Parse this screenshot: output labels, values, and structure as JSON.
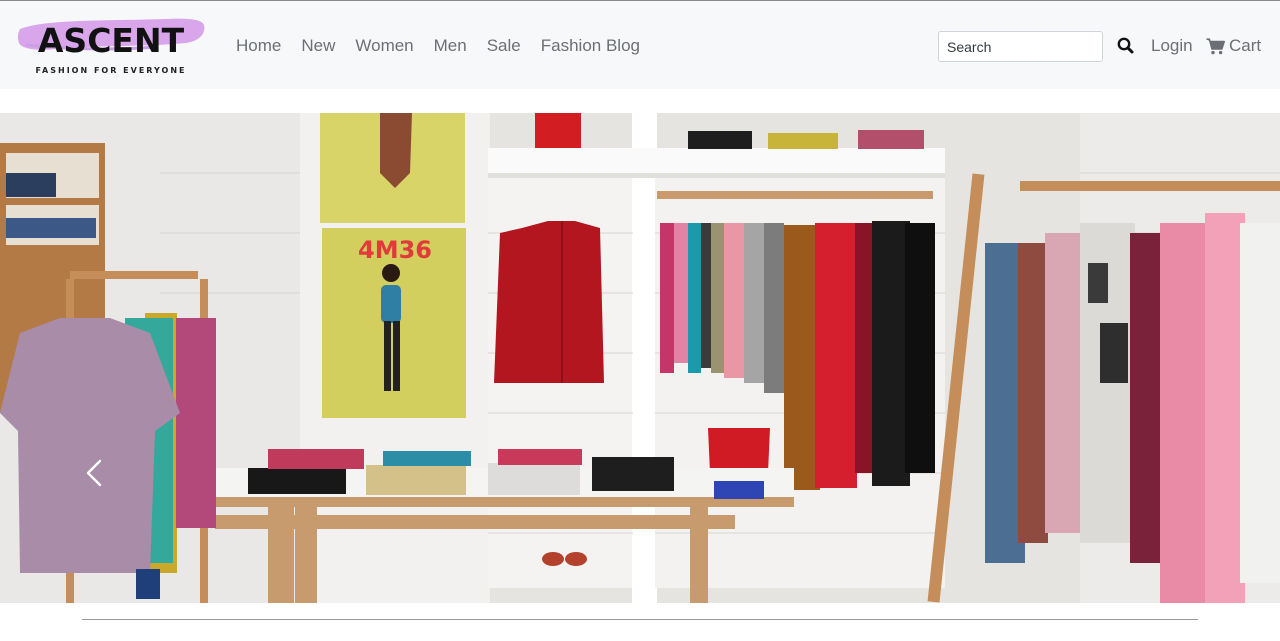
{
  "brand": {
    "name": "ASCENT",
    "tagline": "FASHION FOR EVERYONE",
    "swash_color": "#d9a6ec"
  },
  "nav": {
    "items": [
      {
        "label": "Home"
      },
      {
        "label": "New"
      },
      {
        "label": "Women"
      },
      {
        "label": "Men"
      },
      {
        "label": "Sale"
      },
      {
        "label": "Fashion Blog"
      }
    ]
  },
  "search": {
    "placeholder": "Search",
    "icon": "search-icon"
  },
  "account": {
    "login_label": "Login",
    "cart_label": "Cart",
    "cart_icon": "shopping-cart-icon"
  },
  "hero": {
    "poster_text": "4M36",
    "prev_icon": "chevron-left-icon"
  }
}
